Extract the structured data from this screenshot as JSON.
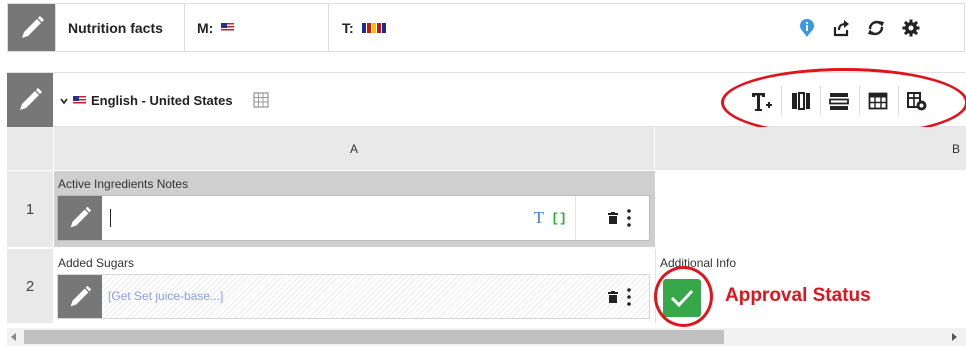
{
  "topbar": {
    "title": "Nutrition facts",
    "master_label": "M:",
    "translations_label": "T:",
    "translation_flag_colors": [
      "#1a2e8a",
      "#c9151e",
      "#f2c300",
      "#c9151e",
      "#1a2e8a"
    ],
    "icons": [
      "info-icon",
      "share-icon",
      "refresh-icon",
      "settings-icon"
    ],
    "colors": {
      "info": "#3b96e6",
      "edit_block": "#777777"
    }
  },
  "section": {
    "language": "English - United States",
    "toolbar_icons": [
      "add-text-icon",
      "columns-icon",
      "rows-icon",
      "table-icon",
      "table-settings-icon"
    ]
  },
  "grid": {
    "columns": [
      "A",
      "B"
    ],
    "rows": [
      {
        "number": "1",
        "cells": [
          {
            "label": "Active Ingredients Notes",
            "value": "",
            "placeholder": "",
            "icons": [
              "text-format-icon",
              "brackets-icon",
              "delete-icon",
              "more-icon"
            ]
          },
          {
            "label": "",
            "value": ""
          }
        ]
      },
      {
        "number": "2",
        "cells": [
          {
            "label": "Added Sugars",
            "value": "",
            "placeholder": "[Get Set juice-base...]",
            "icons": [
              "delete-icon",
              "more-icon"
            ]
          },
          {
            "label": "Additional Info",
            "value": "",
            "status": "approved",
            "status_color": "#36a84a"
          }
        ]
      }
    ]
  },
  "annotation": {
    "text": "Approval Status",
    "color": "#e3121b"
  }
}
